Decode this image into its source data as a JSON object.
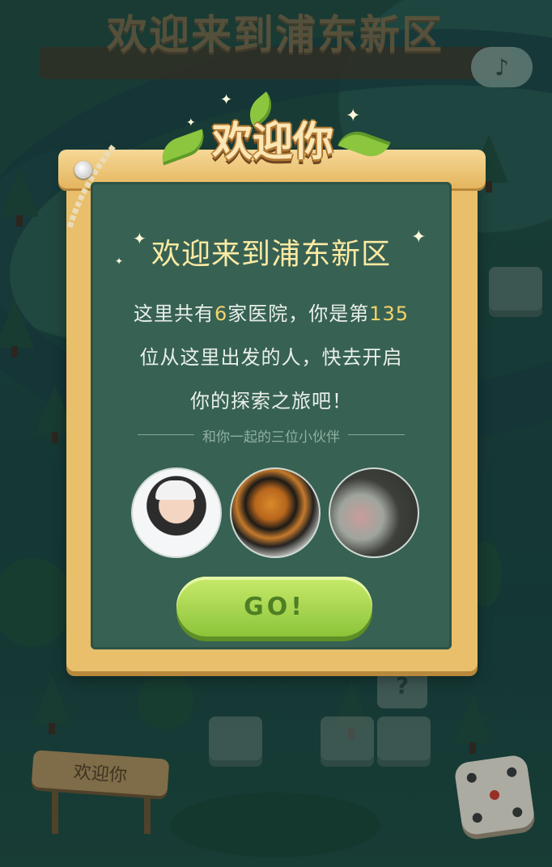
{
  "header": {
    "title": "欢迎来到浦东新区",
    "music_icon": "music-note-icon"
  },
  "modal": {
    "badge": "欢迎你",
    "title": "欢迎来到浦东新区",
    "body": {
      "part1": "这里共有",
      "hospital_count": "6",
      "part2": "家医院，你是第",
      "rank": "135",
      "part3": "位从这里出发的人，快去开启你的探索之旅吧！"
    },
    "friends_label": "和你一起的三位小伙伴",
    "avatars": [
      "avatar-boy",
      "avatar-tiger",
      "avatar-girl"
    ],
    "go_label": "GO!"
  },
  "map": {
    "sign_label": "欢迎你",
    "mystery_tile": "?",
    "dice_icon": "dice-icon"
  },
  "colors": {
    "accent_green": "#8cc43a",
    "highlight_yellow": "#f6d36a",
    "board_green": "#376153",
    "frame_wood": "#e9bf6c"
  }
}
